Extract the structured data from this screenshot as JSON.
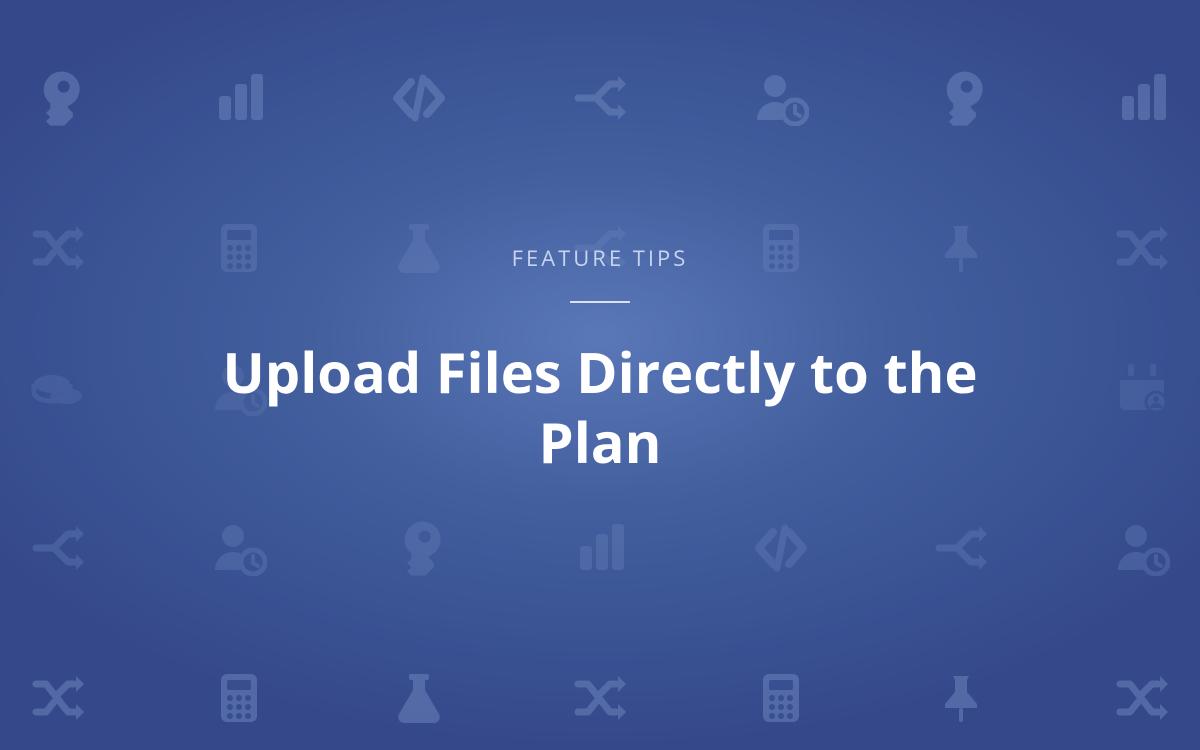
{
  "hero": {
    "eyebrow": "FEATURE TIPS",
    "title": "Upload Files Directly to the Plan"
  },
  "background": {
    "icons_row1": [
      "key",
      "bar-chart",
      "code",
      "split",
      "user-clock",
      "key",
      "bar-chart"
    ],
    "icons_row2": [
      "shuffle",
      "calculator",
      "flask",
      "split",
      "calculator",
      "pin",
      "shuffle"
    ],
    "icons_row3": [
      "coins",
      "user-clock",
      "blank",
      "blank",
      "blank",
      "blank",
      "calendar-user"
    ],
    "icons_row4": [
      "split",
      "user-clock",
      "key",
      "bar-chart",
      "code",
      "split",
      "user-clock"
    ],
    "icons_row5": [
      "shuffle",
      "calculator",
      "flask",
      "shuffle",
      "calculator",
      "pin",
      "shuffle"
    ]
  },
  "colors": {
    "bg_center": "#5a77b8",
    "bg_edge": "#35488a",
    "icon_fill": "#6b84bd",
    "eyebrow_text": "#c6d4f0",
    "title_text": "#ffffff",
    "divider": "#d9e2f5"
  }
}
